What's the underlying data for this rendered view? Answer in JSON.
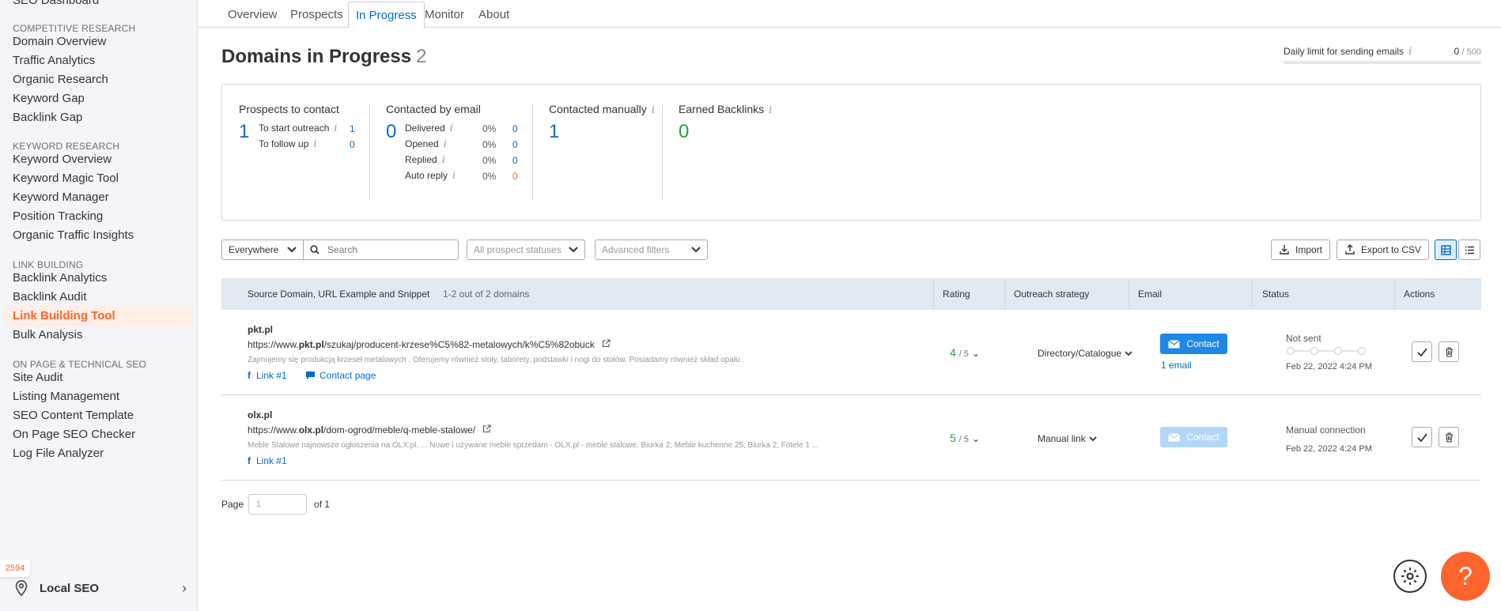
{
  "sidebar": {
    "top_cut": "SEO Dashboard",
    "groups": [
      {
        "title": "COMPETITIVE RESEARCH",
        "items": [
          "Domain Overview",
          "Traffic Analytics",
          "Organic Research",
          "Keyword Gap",
          "Backlink Gap"
        ]
      },
      {
        "title": "KEYWORD RESEARCH",
        "items": [
          "Keyword Overview",
          "Keyword Magic Tool",
          "Keyword Manager",
          "Position Tracking",
          "Organic Traffic Insights"
        ]
      },
      {
        "title": "LINK BUILDING",
        "items": [
          "Backlink Analytics",
          "Backlink Audit",
          "Link Building Tool",
          "Bulk Analysis"
        ]
      },
      {
        "title": "ON PAGE & TECHNICAL SEO",
        "items": [
          "Site Audit",
          "Listing Management",
          "SEO Content Template",
          "On Page SEO Checker",
          "Log File Analyzer"
        ]
      }
    ],
    "active_item": "Link Building Tool",
    "badge": "2594",
    "local_seo": "Local SEO"
  },
  "tabs": [
    "Overview",
    "Prospects",
    "In Progress",
    "Monitor",
    "About"
  ],
  "active_tab": "In Progress",
  "title": "Domains in Progress",
  "title_count": "2",
  "daily_limit": {
    "label": "Daily limit for sending emails",
    "used": "0",
    "total": "500",
    "fraction": 0
  },
  "stats": {
    "prospects": {
      "title": "Prospects to contact",
      "total": "1",
      "rows": [
        {
          "label": "To start outreach",
          "value": "1"
        },
        {
          "label": "To follow up",
          "value": "0"
        }
      ]
    },
    "email": {
      "title": "Contacted by email",
      "total": "0",
      "rows": [
        {
          "label": "Delivered",
          "pct": "0%",
          "value": "0"
        },
        {
          "label": "Opened",
          "pct": "0%",
          "value": "0"
        },
        {
          "label": "Replied",
          "pct": "0%",
          "value": "0"
        },
        {
          "label": "Auto reply",
          "pct": "0%",
          "value": "0"
        }
      ]
    },
    "manual": {
      "title": "Contacted manually",
      "total": "1"
    },
    "earned": {
      "title": "Earned Backlinks",
      "total": "0"
    }
  },
  "filters": {
    "scope": "Everywhere",
    "search_placeholder": "Search",
    "statuses": "All prospect statuses",
    "advanced": "Advanced filters",
    "import": "Import",
    "export": "Export to CSV"
  },
  "table": {
    "headers": {
      "source": "Source Domain, URL Example and Snippet",
      "count": "1-2 out of 2 domains",
      "rating": "Rating",
      "strategy": "Outreach strategy",
      "email": "Email",
      "status": "Status",
      "actions": "Actions"
    },
    "rows": [
      {
        "domain": "pkt.pl",
        "url_pre": "https://www.",
        "url_bold": "pkt.pl",
        "url_post": "/szukaj/producent-krzese%C5%82-metalowych/k%C5%82obuck",
        "snippet": "Zajmujemy się produkcją krzeseł metalowych . Oferujemy również stoły, taborety, podstawki i nogi do stołów. Posiadamy również skład opału .",
        "link": "Link #1",
        "contact_page": "Contact page",
        "rating": "4",
        "rating_max": "/ 5",
        "strategy": "Directory/Catalogue",
        "contact": "Contact",
        "email_count": "1 email",
        "status": "Not sent",
        "date": "Feb 22, 2022 4:24 PM"
      },
      {
        "domain": "olx.pl",
        "url_pre": "https://www.",
        "url_bold": "olx.pl",
        "url_post": "/dom-ogrod/meble/q-meble-stalowe/",
        "snippet": "Meble Stalowe najnowsze ogłoszenia na OLX.pl. ... Nowe i używane meble sprzedam - OLX.pl - meble stalowe. Biurka 2; Meble kuchenne 25; Biurka 2; Fotele 1 ...",
        "link": "Link #1",
        "rating": "5",
        "rating_max": "/ 5",
        "strategy": "Manual link",
        "contact": "Contact",
        "status": "Manual connection",
        "date": "Feb 22, 2022 4:24 PM"
      }
    ]
  },
  "pager": {
    "label": "Page",
    "placeholder": "1",
    "of": "of",
    "total": "1"
  },
  "help": "?",
  "colors": {
    "accent": "#ff642d",
    "link": "#006dca",
    "green": "#22a33a",
    "button": "#1e88e5"
  }
}
